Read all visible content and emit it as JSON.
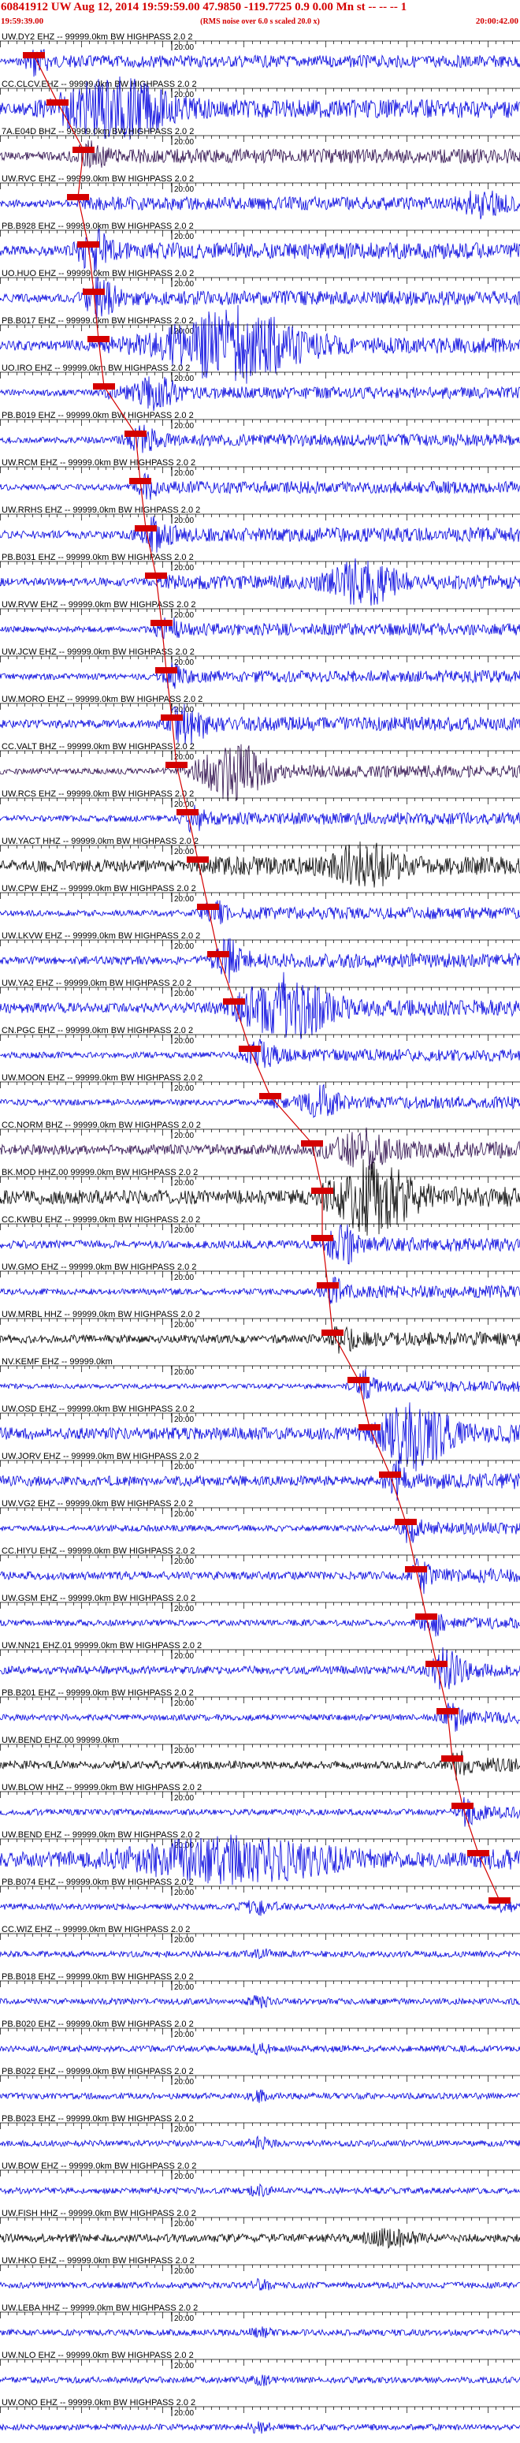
{
  "header": {
    "title": "60841912 UW Aug 12, 2014 19:59:59.00   47.9850 -119.7725  0.9 0.00 Mn st -- -- -- 1",
    "start_time": "19:59:39.00",
    "note": "(RMS noise over 6.0 s scaled 20.0 x)",
    "end_time": "20:00:42.00"
  },
  "tick_label": "20:00",
  "colors": {
    "header": "#d40000",
    "pick": "#d40000",
    "blue": "#0000dd",
    "black": "#000000",
    "purple": "#2b0a4a"
  },
  "traces": [
    {
      "label": "UW.DY2 EHZ -- 99999.0km BW  HIGHPASS  2.0  2",
      "color": "blue",
      "pick": 0.065,
      "amp": 0.15,
      "burst_at": 0.07,
      "burst_w": 0.02,
      "burst_amp": 0.6
    },
    {
      "label": "CC.CLCV.EHZ -- 99999.0km BW  HIGHPASS  2.0  2",
      "color": "blue",
      "pick": 0.11,
      "amp": 0.3,
      "burst_at": 0.22,
      "burst_w": 0.1,
      "burst_amp": 1.2
    },
    {
      "label": "7A.E04D BHZ -- 99999.0km BW  HIGHPASS  2.0  2",
      "color": "purple",
      "pick": 0.16,
      "amp": 0.2,
      "burst_at": 0.17,
      "burst_w": 0.03,
      "burst_amp": 0.5
    },
    {
      "label": "UW.RVC EHZ -- 99999.0km BW  HIGHPASS  2.0  2",
      "color": "blue",
      "pick": 0.15,
      "amp": 0.18,
      "burst_at": 0.93,
      "burst_w": 0.04,
      "burst_amp": 0.5
    },
    {
      "label": "PB.B928 EHZ -- 99999.0km BW  HIGHPASS  2.0  2",
      "color": "blue",
      "pick": 0.17,
      "amp": 0.25,
      "burst_at": 0.18,
      "burst_w": 0.03,
      "burst_amp": 0.9
    },
    {
      "label": "UO.HUO EHZ -- 99999.0km BW  HIGHPASS  2.0  2",
      "color": "blue",
      "pick": 0.18,
      "amp": 0.2,
      "burst_at": 0.19,
      "burst_w": 0.03,
      "burst_amp": 0.8
    },
    {
      "label": "PB.B017 EHZ -- 99999.0km BW  HIGHPASS  2.0  2",
      "color": "blue",
      "pick": 0.19,
      "amp": 0.25,
      "burst_at": 0.45,
      "burst_w": 0.12,
      "burst_amp": 1.6
    },
    {
      "label": "UO.IRO EHZ -- 99999.0km BW  HIGHPASS  2.0  2",
      "color": "blue",
      "pick": 0.2,
      "amp": 0.15,
      "burst_at": 0.3,
      "burst_w": 0.04,
      "burst_amp": 0.6
    },
    {
      "label": "PB.B019 EHZ -- 99999.0km BW  HIGHPASS  2.0  2",
      "color": "blue",
      "pick": 0.26,
      "amp": 0.15,
      "burst_at": 0.27,
      "burst_w": 0.03,
      "burst_amp": 0.5
    },
    {
      "label": "UW.RCM EHZ -- 99999.0km BW  HIGHPASS  2.0  2",
      "color": "blue",
      "pick": 0.27,
      "amp": 0.15,
      "burst_at": 0.28,
      "burst_w": 0.02,
      "burst_amp": 0.4
    },
    {
      "label": "UW.RRHS EHZ -- 99999.0km BW  HIGHPASS  2.0  2",
      "color": "blue",
      "pick": 0.28,
      "amp": 0.2,
      "burst_at": 0.3,
      "burst_w": 0.03,
      "burst_amp": 0.6
    },
    {
      "label": "PB.B031 EHZ -- 99999.0km BW  HIGHPASS  2.0  2",
      "color": "blue",
      "pick": 0.3,
      "amp": 0.2,
      "burst_at": 0.7,
      "burst_w": 0.06,
      "burst_amp": 0.9
    },
    {
      "label": "UW.RVW EHZ -- 99999.0km BW  HIGHPASS  2.0  2",
      "color": "blue",
      "pick": 0.31,
      "amp": 0.15,
      "burst_at": 0.32,
      "burst_w": 0.02,
      "burst_amp": 0.6
    },
    {
      "label": "UW.JCW EHZ -- 99999.0km BW  HIGHPASS  2.0  2",
      "color": "blue",
      "pick": 0.32,
      "amp": 0.15,
      "burst_at": 0.33,
      "burst_w": 0.02,
      "burst_amp": 0.4
    },
    {
      "label": "UW.MORO EHZ -- 99999.0km BW  HIGHPASS  2.0  2",
      "color": "blue",
      "pick": 0.33,
      "amp": 0.2,
      "burst_at": 0.36,
      "burst_w": 0.04,
      "burst_amp": 0.7
    },
    {
      "label": "CC.VALT BHZ -- 99999.0km BW  HIGHPASS  2.0  2",
      "color": "purple",
      "pick": 0.34,
      "amp": 0.15,
      "burst_at": 0.45,
      "burst_w": 0.06,
      "burst_amp": 1.2
    },
    {
      "label": "UW.RCS EHZ -- 99999.0km BW  HIGHPASS  2.0  2",
      "color": "blue",
      "pick": 0.36,
      "amp": 0.15,
      "burst_at": 0.37,
      "burst_w": 0.02,
      "burst_amp": 0.5
    },
    {
      "label": "UW.YACT HHZ -- 99999.0km BW  HIGHPASS  2.0  2",
      "color": "black",
      "pick": 0.38,
      "amp": 0.3,
      "burst_at": 0.7,
      "burst_w": 0.06,
      "burst_amp": 0.8
    },
    {
      "label": "UW.CPW EHZ -- 99999.0km BW  HIGHPASS  2.0  2",
      "color": "blue",
      "pick": 0.4,
      "amp": 0.15,
      "burst_at": 0.41,
      "burst_w": 0.02,
      "burst_amp": 0.6
    },
    {
      "label": "UW.LKVW EHZ -- 99999.0km BW  HIGHPASS  2.0  2",
      "color": "blue",
      "pick": 0.42,
      "amp": 0.2,
      "burst_at": 0.44,
      "burst_w": 0.03,
      "burst_amp": 0.8
    },
    {
      "label": "UW.YA2 EHZ -- 99999.0km BW  HIGHPASS  2.0  2",
      "color": "blue",
      "pick": 0.45,
      "amp": 0.25,
      "burst_at": 0.55,
      "burst_w": 0.08,
      "burst_amp": 1.4
    },
    {
      "label": "CN.PGC EHZ -- 99999.0km BW  HIGHPASS  2.0  2",
      "color": "blue",
      "pick": 0.48,
      "amp": 0.15,
      "burst_at": 0.5,
      "burst_w": 0.03,
      "burst_amp": 0.5
    },
    {
      "label": "UW.MOON EHZ -- 99999.0km BW  HIGHPASS  2.0  2",
      "color": "blue",
      "pick": 0.52,
      "amp": 0.15,
      "burst_at": 0.62,
      "burst_w": 0.03,
      "burst_amp": 0.6
    },
    {
      "label": "CC.NORM BHZ -- 99999.0km BW  HIGHPASS  2.0  2",
      "color": "purple",
      "pick": 0.6,
      "amp": 0.25,
      "burst_at": 0.7,
      "burst_w": 0.05,
      "burst_amp": 0.7
    },
    {
      "label": "BK.MOD HHZ.00 99999.0km BW  HIGHPASS  2.0  2",
      "color": "black",
      "pick": 0.62,
      "amp": 0.35,
      "burst_at": 0.72,
      "burst_w": 0.07,
      "burst_amp": 1.5
    },
    {
      "label": "CC.KWBU EHZ -- 99999.0km BW  HIGHPASS  2.0  2",
      "color": "blue",
      "pick": 0.62,
      "amp": 0.2,
      "burst_at": 0.66,
      "burst_w": 0.03,
      "burst_amp": 0.7
    },
    {
      "label": "UW.GMO EHZ -- 99999.0km BW  HIGHPASS  2.0  2",
      "color": "blue",
      "pick": 0.63,
      "amp": 0.15,
      "burst_at": 0.64,
      "burst_w": 0.02,
      "burst_amp": 0.5
    },
    {
      "label": "UW.MRBL HHZ -- 99999.0km BW  HIGHPASS  2.0  2",
      "color": "black",
      "pick": 0.64,
      "amp": 0.2,
      "burst_at": 0.66,
      "burst_w": 0.02,
      "burst_amp": 0.5
    },
    {
      "label": "NV.KEMF EHZ -- 99999.0km",
      "color": "blue",
      "pick": 0.69,
      "amp": 0.12,
      "burst_at": 0.7,
      "burst_w": 0.02,
      "burst_amp": 0.6
    },
    {
      "label": "UW.OSD EHZ -- 99999.0km BW  HIGHPASS  2.0  2",
      "color": "blue",
      "pick": 0.71,
      "amp": 0.3,
      "burst_at": 0.8,
      "burst_w": 0.06,
      "burst_amp": 1.4
    },
    {
      "label": "UW.JORV EHZ -- 99999.0km BW  HIGHPASS  2.0  2",
      "color": "blue",
      "pick": 0.75,
      "amp": 0.25,
      "burst_at": 0.76,
      "burst_w": 0.02,
      "burst_amp": 0.7
    },
    {
      "label": "UW.VG2 EHZ -- 99999.0km BW  HIGHPASS  2.0  2",
      "color": "blue",
      "pick": 0.78,
      "amp": 0.15,
      "burst_at": 0.79,
      "burst_w": 0.02,
      "burst_amp": 0.5
    },
    {
      "label": "CC.HIYU EHZ -- 99999.0km BW  HIGHPASS  2.0  2",
      "color": "blue",
      "pick": 0.8,
      "amp": 0.2,
      "burst_at": 0.81,
      "burst_w": 0.02,
      "burst_amp": 0.6
    },
    {
      "label": "UW.GSM EHZ -- 99999.0km BW  HIGHPASS  2.0  2",
      "color": "blue",
      "pick": 0.82,
      "amp": 0.15,
      "burst_at": 0.83,
      "burst_w": 0.02,
      "burst_amp": 0.5
    },
    {
      "label": "UW.NN21 EHZ.01 99999.0km BW  HIGHPASS  2.0  2",
      "color": "blue",
      "pick": 0.84,
      "amp": 0.2,
      "burst_at": 0.86,
      "burst_w": 0.03,
      "burst_amp": 0.9
    },
    {
      "label": "PB.B201 EHZ -- 99999.0km BW  HIGHPASS  2.0  2",
      "color": "blue",
      "pick": 0.86,
      "amp": 0.15,
      "burst_at": 0.87,
      "burst_w": 0.02,
      "burst_amp": 0.5
    },
    {
      "label": "UW.BEND EHZ.00 99999.0km",
      "color": "black",
      "pick": 0.87,
      "amp": 0.2,
      "burst_at": 0.88,
      "burst_w": 0.02,
      "burst_amp": 0.5
    },
    {
      "label": "UW.BLOW HHZ -- 99999.0km BW  HIGHPASS  2.0  2",
      "color": "blue",
      "pick": 0.89,
      "amp": 0.15,
      "burst_at": 0.9,
      "burst_w": 0.02,
      "burst_amp": 0.5
    },
    {
      "label": "UW.BEND EHZ -- 99999.0km BW  HIGHPASS  2.0  2",
      "color": "blue",
      "pick": 0.92,
      "amp": 0.35,
      "burst_at": 0.45,
      "burst_w": 0.2,
      "burst_amp": 0.9
    },
    {
      "label": "PB.B074 EHZ -- 99999.0km BW  HIGHPASS  2.0  2",
      "color": "blue",
      "pick": 0.96,
      "amp": 0.15,
      "burst_at": 0.5,
      "burst_w": 0.03,
      "burst_amp": 0.3
    },
    {
      "label": "CC.WIZ EHZ -- 99999.0km BW  HIGHPASS  2.0  2",
      "color": "blue",
      "pick": null,
      "amp": 0.15,
      "burst_at": 0.5,
      "burst_w": 0.02,
      "burst_amp": 0.2
    },
    {
      "label": "PB.B018 EHZ -- 99999.0km BW  HIGHPASS  2.0  2",
      "color": "blue",
      "pick": null,
      "amp": 0.15,
      "burst_at": 0.5,
      "burst_w": 0.02,
      "burst_amp": 0.2
    },
    {
      "label": "PB.B020 EHZ -- 99999.0km BW  HIGHPASS  2.0  2",
      "color": "blue",
      "pick": null,
      "amp": 0.15,
      "burst_at": 0.5,
      "burst_w": 0.02,
      "burst_amp": 0.2
    },
    {
      "label": "PB.B022 EHZ -- 99999.0km BW  HIGHPASS  2.0  2",
      "color": "blue",
      "pick": null,
      "amp": 0.15,
      "burst_at": 0.5,
      "burst_w": 0.02,
      "burst_amp": 0.2
    },
    {
      "label": "PB.B023 EHZ -- 99999.0km BW  HIGHPASS  2.0  2",
      "color": "blue",
      "pick": null,
      "amp": 0.15,
      "burst_at": 0.5,
      "burst_w": 0.02,
      "burst_amp": 0.2
    },
    {
      "label": "UW.BOW EHZ -- 99999.0km BW  HIGHPASS  2.0  2",
      "color": "blue",
      "pick": null,
      "amp": 0.15,
      "burst_at": 0.5,
      "burst_w": 0.02,
      "burst_amp": 0.2
    },
    {
      "label": "UW.FISH HHZ -- 99999.0km BW  HIGHPASS  2.0  2",
      "color": "black",
      "pick": null,
      "amp": 0.2,
      "burst_at": 0.75,
      "burst_w": 0.05,
      "burst_amp": 0.3
    },
    {
      "label": "UW.HKO EHZ -- 99999.0km BW  HIGHPASS  2.0  2",
      "color": "blue",
      "pick": null,
      "amp": 0.15,
      "burst_at": 0.5,
      "burst_w": 0.02,
      "burst_amp": 0.2
    },
    {
      "label": "UW.LEBA HHZ -- 99999.0km BW  HIGHPASS  2.0  2",
      "color": "blue",
      "pick": null,
      "amp": 0.15,
      "burst_at": 0.5,
      "burst_w": 0.02,
      "burst_amp": 0.2
    },
    {
      "label": "UW.NLO EHZ -- 99999.0km BW  HIGHPASS  2.0  2",
      "color": "blue",
      "pick": null,
      "amp": 0.15,
      "burst_at": 0.5,
      "burst_w": 0.02,
      "burst_amp": 0.2
    },
    {
      "label": "UW.ONO EHZ -- 99999.0km BW  HIGHPASS  2.0  2",
      "color": "blue",
      "pick": null,
      "amp": 0.15,
      "burst_at": 0.5,
      "burst_w": 0.02,
      "burst_amp": 0.2
    }
  ]
}
